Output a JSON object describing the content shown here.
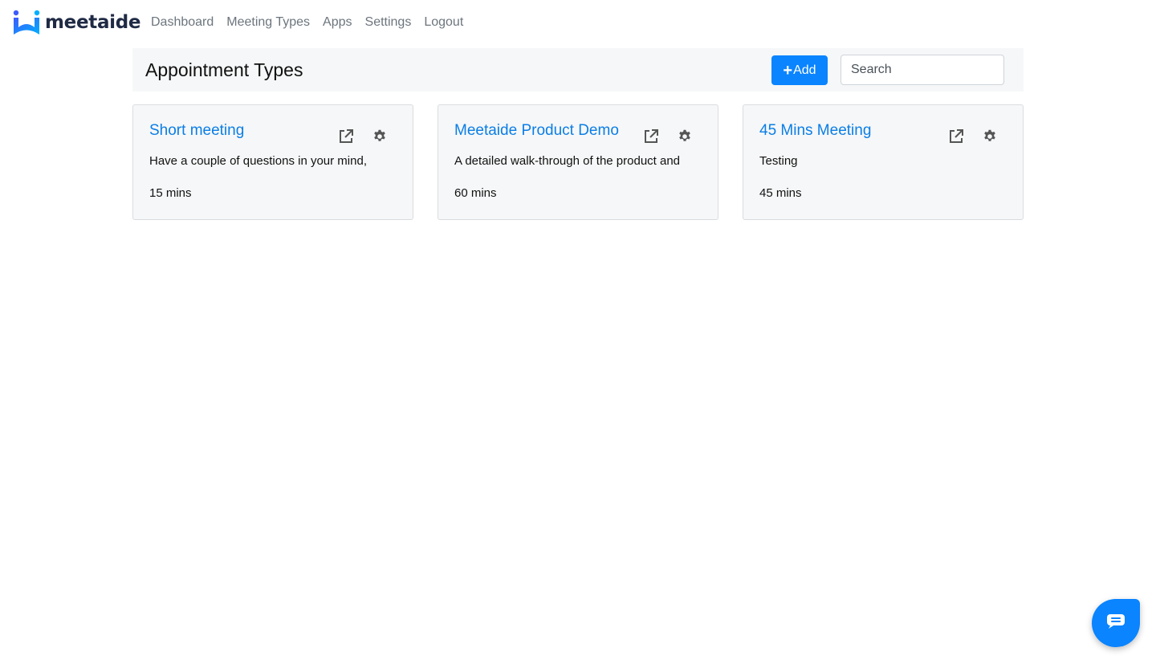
{
  "brand": {
    "name": "meetaide"
  },
  "nav": {
    "items": [
      {
        "label": "Dashboard"
      },
      {
        "label": "Meeting Types"
      },
      {
        "label": "Apps"
      },
      {
        "label": "Settings"
      },
      {
        "label": "Logout"
      }
    ]
  },
  "header": {
    "title": "Appointment Types",
    "add_label": "Add",
    "search_placeholder": "Search"
  },
  "cards": [
    {
      "title": "Short meeting",
      "description": "Have a couple of questions in your mind,",
      "duration": "15 mins"
    },
    {
      "title": "Meetaide Product Demo",
      "description": "A detailed walk-through of the product and",
      "duration": "60 mins"
    },
    {
      "title": "45 Mins Meeting",
      "description": "Testing",
      "duration": "45 mins"
    }
  ],
  "icons": {
    "card_open": "external-link-icon",
    "card_settings": "gear-icon",
    "chat": "chat-icon"
  },
  "colors": {
    "primary": "#0a84ff",
    "link": "#0a7ee6",
    "brand_text": "#1f2a44",
    "panel_bg": "#f6f7f8"
  }
}
